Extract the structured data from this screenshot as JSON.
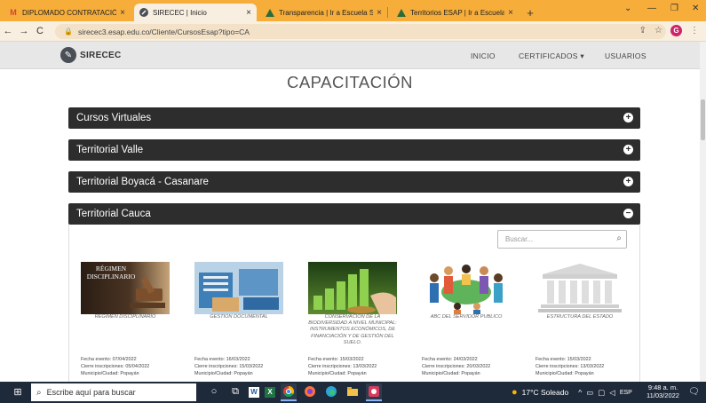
{
  "browser": {
    "tabs": [
      {
        "title": "DIPLOMADO CONTRATACIÓN ES",
        "icon": "gmail-icon",
        "active": false
      },
      {
        "title": "SIRECEC | Inicio",
        "icon": "sirecec-icon",
        "active": true
      },
      {
        "title": "Transparencia | Ir a Escuela Supe",
        "icon": "esap-icon",
        "active": false
      },
      {
        "title": "Territorios ESAP | Ir a Escuela Sup",
        "icon": "esap-icon",
        "active": false
      }
    ],
    "url": "sirecec3.esap.edu.co/Cliente/CursosEsap?tipo=CA",
    "profile_initial": "G"
  },
  "site": {
    "logo_text": "SIRECEC",
    "nav": {
      "inicio": "INICIO",
      "certificados": "CERTIFICADOS ▾",
      "usuarios": "USUARIOS"
    }
  },
  "main": {
    "heading": "CAPACITACIÓN",
    "panels": [
      {
        "label": "Cursos Virtuales",
        "icon": "plus-circle-icon"
      },
      {
        "label": "Territorial Valle",
        "icon": "plus-circle-icon"
      },
      {
        "label": "Territorial Boyacá - Casanare",
        "icon": "plus-circle-icon"
      },
      {
        "label": "Territorial Cauca",
        "icon": "minus-circle-icon"
      }
    ],
    "search_placeholder": "Buscar...",
    "cards": [
      {
        "title": "RÉGIMEN DISCIPLINARIO",
        "image_text": "RÉGIMEN DISCIPLINARIO",
        "fecha": "Fecha evento: 07/04/2022",
        "cierre": "Cierre inscripciones: 05/04/2022",
        "municipio": "Municipio/Ciudad: Popayán"
      },
      {
        "title": "GESTIÓN DOCUMENTAL",
        "fecha": "Fecha evento: 16/03/2022",
        "cierre": "Cierre inscripciones: 15/03/2022",
        "municipio": "Municipio/Ciudad: Popayán"
      },
      {
        "title": "CONSERVACIÓN DE LA BIODIVERSIDAD A NIVEL MUNICIPAL: INSTRUMENTOS ECONÓMICOS, DE FINANCIACIÓN Y DE GESTIÓN DEL SUELO.",
        "fecha": "Fecha evento: 15/03/2022",
        "cierre": "Cierre inscripciones: 13/03/2022",
        "municipio": "Municipio/Ciudad: Popayán"
      },
      {
        "title": "ABC DEL SERVIDOR PÚBLICO",
        "fecha": "Fecha evento: 24/03/2022",
        "cierre": "Cierre inscripciones: 20/03/2022",
        "municipio": "Municipio/Ciudad: Popayán"
      },
      {
        "title": "ESTRUCTURA DEL ESTADO",
        "fecha": "Fecha evento: 15/03/2022",
        "cierre": "Cierre inscripciones: 13/03/2022",
        "municipio": "Municipio/Ciudad: Popayán"
      }
    ]
  },
  "taskbar": {
    "search_placeholder": "Escribe aquí para buscar",
    "weather": "17°C  Soleado",
    "lang": "ESP",
    "time": "9:48 a. m.",
    "date": "11/03/2022"
  },
  "colors": {
    "tab_strip": "#f6ad3a",
    "panel_bg": "#2d2d2d",
    "taskbar": "#1e2a3a"
  }
}
